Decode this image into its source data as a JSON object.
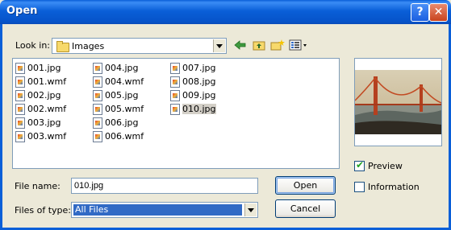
{
  "window": {
    "title": "Open",
    "help_glyph": "?",
    "close_glyph": "✕"
  },
  "look_in": {
    "label": "Look in:",
    "value": "Images",
    "icon": "folder-icon"
  },
  "toolbar": {
    "icons": [
      "back-arrow-icon",
      "up-one-level-icon",
      "create-new-folder-icon",
      "view-menu-icon"
    ]
  },
  "files": [
    {
      "name": "001.jpg",
      "selected": false
    },
    {
      "name": "001.wmf",
      "selected": false
    },
    {
      "name": "002.jpg",
      "selected": false
    },
    {
      "name": "002.wmf",
      "selected": false
    },
    {
      "name": "003.jpg",
      "selected": false
    },
    {
      "name": "003.wmf",
      "selected": false
    },
    {
      "name": "004.jpg",
      "selected": false
    },
    {
      "name": "004.wmf",
      "selected": false
    },
    {
      "name": "005.jpg",
      "selected": false
    },
    {
      "name": "005.wmf",
      "selected": false
    },
    {
      "name": "006.jpg",
      "selected": false
    },
    {
      "name": "006.wmf",
      "selected": false
    },
    {
      "name": "007.jpg",
      "selected": false
    },
    {
      "name": "008.jpg",
      "selected": false
    },
    {
      "name": "009.jpg",
      "selected": false
    },
    {
      "name": "010.jpg",
      "selected": true
    }
  ],
  "file_name": {
    "label": "File name:",
    "value": "010.jpg"
  },
  "file_type": {
    "label": "Files of type:",
    "value": "All Files"
  },
  "buttons": {
    "open": "Open",
    "cancel": "Cancel"
  },
  "options": {
    "preview": {
      "label": "Preview",
      "checked": true
    },
    "information": {
      "label": "Information",
      "checked": false
    }
  },
  "colors": {
    "titlebar": "#0a5fd8",
    "selection": "#316ac5",
    "dialog_bg": "#ece9d8"
  }
}
